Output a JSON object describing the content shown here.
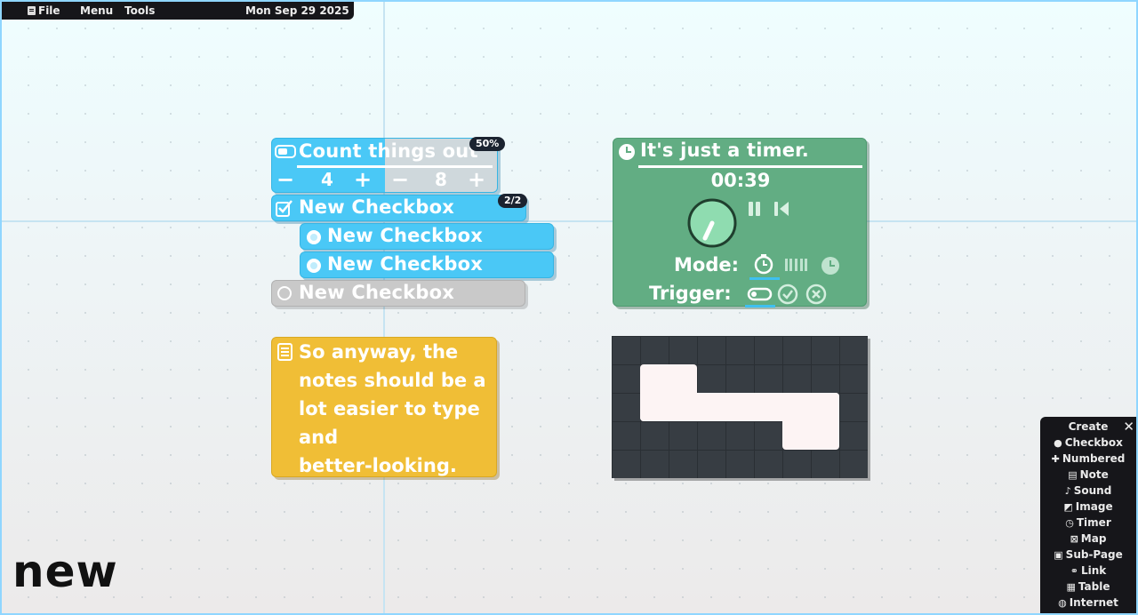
{
  "menubar": {
    "file": "File",
    "menu": "Menu",
    "tools": "Tools",
    "date": "Mon Sep 29 2025"
  },
  "counter_card": {
    "title": "Count things out",
    "badge": "50%",
    "progress": 0.5,
    "left_value": "4",
    "right_value": "8",
    "minus": "−",
    "plus": "+"
  },
  "checkbox_group": {
    "title": "New Checkbox",
    "badge": "2/2",
    "children": [
      {
        "label": "New Checkbox",
        "checked": true
      },
      {
        "label": "New Checkbox",
        "checked": true
      }
    ]
  },
  "checkbox_unchecked": {
    "label": "New Checkbox",
    "checked": false
  },
  "timer": {
    "title": "It's just a timer.",
    "time": "00:39",
    "mode_label": "Mode:",
    "trigger_label": "Trigger:"
  },
  "note": {
    "lines": [
      "So anyway, the",
      "notes should be a",
      "lot easier to type",
      "and",
      "better-looking."
    ]
  },
  "create_panel": {
    "title": "Create",
    "items": [
      "Checkbox",
      "Numbered",
      "Note",
      "Sound",
      "Image",
      "Timer",
      "Map",
      "Sub-Page",
      "Link",
      "Table",
      "Internet"
    ]
  },
  "page_name": "new",
  "colors": {
    "blue": "#4ac8f6",
    "green": "#62ad83",
    "yellow": "#f0be36",
    "gray": "#c9c9c9",
    "dark": "#16161a"
  }
}
